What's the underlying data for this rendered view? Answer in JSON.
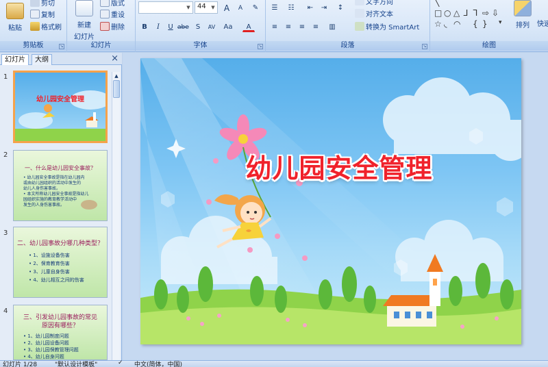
{
  "ribbon": {
    "clipboard": {
      "paste": "粘贴",
      "cut": "剪切",
      "copy": "复制",
      "format_painter": "格式刷",
      "label": "剪贴板"
    },
    "slides": {
      "new_slide": "新建",
      "new_slide_2": "幻灯片",
      "layout": "版式",
      "reset": "重设",
      "delete": "删除",
      "label": "幻灯片"
    },
    "font": {
      "font_name": "",
      "font_size": "44",
      "bold": "B",
      "italic": "I",
      "underline": "U",
      "strike": "abe",
      "shadow": "S",
      "spacing": "AV",
      "case": "Aa",
      "color": "A",
      "grow": "A",
      "shrink": "A",
      "label": "字体"
    },
    "paragraph": {
      "text_direction": "文字方向",
      "align_text": "对齐文本",
      "smartart": "转换为 SmartArt",
      "label": "段落"
    },
    "drawing": {
      "arrange": "排列",
      "quick_styles": "快速",
      "label": "绘图"
    }
  },
  "left_panel": {
    "tab_slides": "幻灯片",
    "tab_outline": "大纲",
    "close": "×",
    "thumbnails": [
      {
        "num": "1",
        "title": "幼儿园安全管理"
      },
      {
        "num": "2",
        "title": "一、什么是幼儿园安全事故？",
        "lines": [
          "• 幼儿园安全事故是指在幼儿园内",
          "  或由幼儿园组织的活动中发生的",
          "  幼儿人身伤害事故。",
          "• 本文所称幼儿园安全事故是指幼儿",
          "  园组织实施的教育教学活动中",
          "  发生的人身伤害事故。"
        ]
      },
      {
        "num": "3",
        "title": "二、幼儿园事故分哪几种类型？",
        "lines": [
          "• 1、设施设备伤害",
          "• 2、保育教育伤害",
          "• 3、儿童自身伤害",
          "• 4、幼儿相互之间的伤害"
        ]
      },
      {
        "num": "4",
        "title": "三、引发幼儿园事故的常见",
        "title2": "原因有哪些？",
        "lines": [
          "• 1、幼儿园制度问题",
          "• 2、幼儿园设备问题",
          "• 3、幼儿园保教管理问题",
          "• 4、幼儿自身问题"
        ]
      }
    ]
  },
  "slide": {
    "title": "幼儿园安全管理"
  },
  "status": {
    "slide_pos": "幻灯片 1/28",
    "theme": "\"默认设计模板\"",
    "language": "中文(简体，中国)"
  },
  "colors": {
    "accent": "#15428b",
    "title_red": "#f0222b",
    "sky": "#7fc6f4",
    "grass": "#8fd34a",
    "selection": "#f6a24a"
  }
}
